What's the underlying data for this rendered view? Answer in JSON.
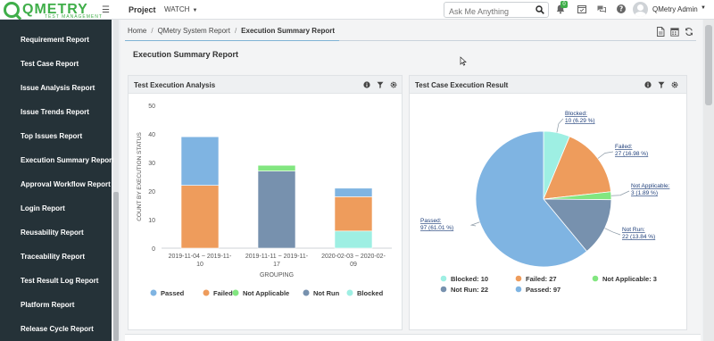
{
  "app": {
    "logo_text": "QMETRY",
    "logo_sub": "TEST MANAGEMENT"
  },
  "topnav": {
    "project": "Project",
    "watch": "WATCH",
    "notification_count": "0"
  },
  "search": {
    "placeholder": "Ask Me Anything"
  },
  "user": {
    "name": "QMetry Admin"
  },
  "sidebar": {
    "items": [
      {
        "label": "Requirement Report"
      },
      {
        "label": "Test Case Report"
      },
      {
        "label": "Issue Analysis Report"
      },
      {
        "label": "Issue Trends Report"
      },
      {
        "label": "Top Issues Report"
      },
      {
        "label": "Execution Summary Report"
      },
      {
        "label": "Approval Workflow Report"
      },
      {
        "label": "Login Report"
      },
      {
        "label": "Reusability Report"
      },
      {
        "label": "Traceability Report"
      },
      {
        "label": "Test Result Log Report"
      },
      {
        "label": "Platform Report"
      },
      {
        "label": "Release Cycle Report"
      }
    ]
  },
  "breadcrumb": {
    "home": "Home",
    "parent": "QMetry System Report",
    "current": "Execution Summary Report"
  },
  "page": {
    "title": "Execution Summary Report"
  },
  "panels": {
    "left_title": "Test Execution Analysis",
    "right_title": "Test Case Execution Result"
  },
  "colors": {
    "passed": "#7fb4e2",
    "failed": "#ee9c5c",
    "not_applicable": "#82e680",
    "not_run": "#7791ae",
    "blocked": "#9eefe3"
  },
  "chart_data": [
    {
      "type": "bar",
      "stacked": true,
      "title": "Test Execution Analysis",
      "xlabel": "GROUPING",
      "ylabel": "COUNT BY EXECUTION STATUS",
      "ylim": [
        0,
        50
      ],
      "yticks": [
        "0",
        "10",
        "20",
        "30",
        "40",
        "50"
      ],
      "categories": [
        "2019-11-04 ~ 2019-11-10",
        "2019-11-11 ~ 2019-11-17",
        "2020-02-03 ~ 2020-02-09"
      ],
      "category_lines": [
        [
          "2019-11-04 ~ 2019-11-",
          "10"
        ],
        [
          "2019-11-11 ~ 2019-11-",
          "17"
        ],
        [
          "2020-02-03 ~ 2020-02-",
          "09"
        ]
      ],
      "series": [
        {
          "name": "Passed",
          "values": [
            17,
            0,
            3
          ]
        },
        {
          "name": "Failed",
          "values": [
            22,
            0,
            12
          ]
        },
        {
          "name": "Not Applicable",
          "values": [
            0,
            2,
            0
          ]
        },
        {
          "name": "Not Run",
          "values": [
            0,
            27,
            0
          ]
        },
        {
          "name": "Blocked",
          "values": [
            0,
            0,
            6
          ]
        }
      ],
      "stack_order": [
        "Blocked",
        "Failed",
        "Passed",
        "Not Run",
        "Not Applicable"
      ],
      "legend": [
        "Passed",
        "Failed",
        "Not Applicable",
        "Not Run",
        "Blocked"
      ],
      "legend_position": "bottom"
    },
    {
      "type": "pie",
      "title": "Test Case Execution Result",
      "slices": [
        {
          "name": "Blocked",
          "value": 10,
          "label": "Blocked:",
          "pct_label": "10 (6.29 %)"
        },
        {
          "name": "Failed",
          "value": 27,
          "label": "Failed:",
          "pct_label": "27 (16.98 %)"
        },
        {
          "name": "Not Applicable",
          "value": 3,
          "label": "Not Applicable:",
          "pct_label": "3 (1.89 %)"
        },
        {
          "name": "Not Run",
          "value": 22,
          "label": "Not Run:",
          "pct_label": "22 (13.84 %)"
        },
        {
          "name": "Passed",
          "value": 97,
          "label": "Passed:",
          "pct_label": "97 (61.01 %)"
        }
      ],
      "legend": [
        {
          "name": "Blocked",
          "text": "Blocked: 10"
        },
        {
          "name": "Failed",
          "text": "Failed: 27"
        },
        {
          "name": "Not Applicable",
          "text": "Not Applicable: 3"
        },
        {
          "name": "Not Run",
          "text": "Not Run: 22"
        },
        {
          "name": "Passed",
          "text": "Passed: 97"
        }
      ],
      "legend_position": "bottom"
    }
  ]
}
